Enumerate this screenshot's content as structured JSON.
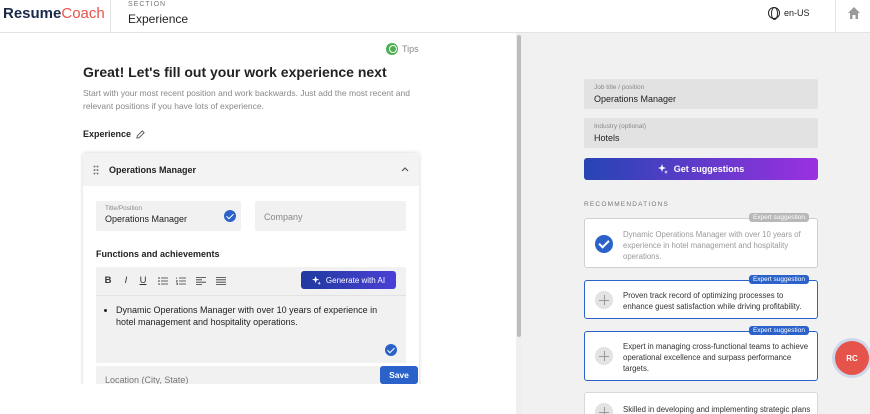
{
  "header": {
    "logo_part1": "Resume",
    "logo_part2": "Coach",
    "section_label": "SECTION",
    "section_value": "Experience",
    "language": "en-US"
  },
  "left": {
    "tips": "Tips",
    "title": "Great! Let's fill out your work experience next",
    "subtitle": "Start with your most recent position and work backwards. Just add the most recent and relevant positions if you have lots of experience.",
    "experience_label": "Experience",
    "card": {
      "title": "Operations Manager",
      "title_field_label": "Title/Position",
      "title_field_value": "Operations Manager",
      "company_placeholder": "Company",
      "functions_title": "Functions and achievements",
      "toolbar": {
        "bold": "B",
        "italic": "I",
        "underline": "U"
      },
      "generate_label": "Generate with AI",
      "editor_bullet": "Dynamic Operations Manager with over 10 years of experience in hotel management and hospitality operations.",
      "location_placeholder": "Location (City, State)"
    },
    "save_label": "Save"
  },
  "right": {
    "job_field_label": "Job title / position",
    "job_field_value": "Operations Manager",
    "industry_label": "Industry (optional)",
    "industry_value": "Hotels",
    "suggestions_button": "Get suggestions",
    "recommendations_title": "RECOMMENDATIONS",
    "recommendations": [
      {
        "badge": "Expert suggestion",
        "text": "Dynamic Operations Manager with over 10 years of experience in hotel management and hospitality operations.",
        "state": "added"
      },
      {
        "badge": "Expert suggestion",
        "text": "Proven track record of optimizing processes to enhance guest satisfaction while driving profitability.",
        "state": "available"
      },
      {
        "badge": "Expert suggestion",
        "text": "Expert in managing cross-functional teams to achieve operational excellence and surpass performance targets.",
        "state": "available"
      },
      {
        "badge": "",
        "text": "Skilled in developing and implementing strategic plans",
        "state": "available"
      }
    ]
  },
  "avatar_initials": "RC",
  "colors": {
    "brand_dark": "#1b2a49",
    "brand_accent": "#e5534b",
    "primary": "#2a62c9",
    "gradient_end": "#9b30e0"
  }
}
